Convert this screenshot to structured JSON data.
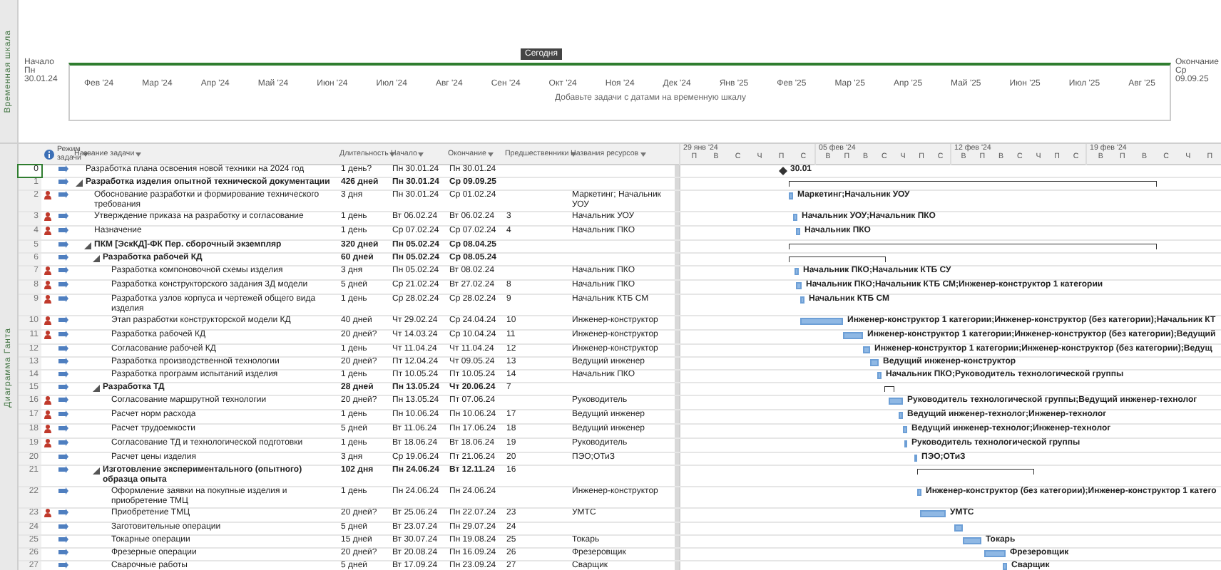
{
  "timeline": {
    "label": "Временная шкала",
    "start_label": "Начало",
    "start_date": "Пн 30.01.24",
    "today": "Сегодня",
    "hint": "Добавьте задачи с датами на временную шкалу",
    "end_label": "Окончание",
    "end_date": "Ср 09.09.25",
    "months": [
      "Фев '24",
      "Мар '24",
      "Апр '24",
      "Май '24",
      "Июн '24",
      "Июл '24",
      "Авг '24",
      "Сен '24",
      "Окт '24",
      "Ноя '24",
      "Дек '24",
      "Янв '25",
      "Фев '25",
      "Мар '25",
      "Апр '25",
      "Май '25",
      "Июн '25",
      "Июл '25",
      "Авг '25"
    ]
  },
  "view_label": "Диаграмма Ганта",
  "columns": [
    "Режим задачи",
    "Название задачи",
    "Длительность",
    "Начало",
    "Окончание",
    "Предшественники",
    "Названия ресурсов"
  ],
  "gantt_header": [
    {
      "label": "29 янв '24",
      "days": [
        "П",
        "В",
        "С",
        "Ч",
        "П",
        "С"
      ]
    },
    {
      "label": "05 фев '24",
      "days": [
        "В",
        "П",
        "В",
        "С",
        "Ч",
        "П",
        "С"
      ]
    },
    {
      "label": "12 фев '24",
      "days": [
        "В",
        "П",
        "В",
        "С",
        "Ч",
        "П",
        "С"
      ]
    },
    {
      "label": "19 фев '24",
      "days": [
        "В",
        "П",
        "В",
        "С",
        "Ч",
        "П"
      ]
    }
  ],
  "rows": [
    {
      "id": "0",
      "kind": "milestone",
      "selected": true,
      "person": false,
      "name": "Разработка плана освоения новой техники на 2024 год",
      "duration": "1 день?",
      "start": "Пн 30.01.24",
      "end": "Пн 30.01.24",
      "bar_label": "30.01"
    },
    {
      "id": "1",
      "kind": "summary",
      "selected": false,
      "person": false,
      "expanded": true,
      "name": "Разработка изделия опытной технической документации",
      "duration": "426 дней",
      "start": "Пн 30.01.24",
      "end": "Ср 09.09.25",
      "children": [
        {
          "id": "2",
          "kind": "task",
          "selected": false,
          "person": true,
          "name": "Обоснование разработки и формирование технического требования",
          "duration": "3 дня",
          "start": "Пн 30.01.24",
          "end": "Ср 01.02.24",
          "res": "Маркетинг; Начальник УОУ",
          "bar_label": "Маркетинг;Начальник УОУ"
        },
        {
          "id": "3",
          "kind": "task",
          "selected": false,
          "person": true,
          "name": "Утверждение приказа на разработку и согласование",
          "duration": "1 день",
          "start": "Вт 06.02.24",
          "end": "Вт 06.02.24",
          "pred": "3",
          "res": "Начальник УОУ",
          "bar_label": "Начальник УОУ;Начальник ПКО"
        },
        {
          "id": "4",
          "kind": "task",
          "selected": false,
          "person": true,
          "name": "Назначение",
          "duration": "1 день",
          "start": "Ср 07.02.24",
          "end": "Ср 07.02.24",
          "pred": "4",
          "res": "Начальник ПКО",
          "bar_label": "Начальник ПКО"
        },
        {
          "id": "5",
          "kind": "summary",
          "selected": false,
          "person": false,
          "expanded": true,
          "name": "ПКМ [ЭскКД]-ФК Пер. сборочный экземпляр",
          "duration": "320 дней",
          "start": "Пн 05.02.24",
          "end": "Ср 08.04.25",
          "children": [
            {
              "id": "6",
              "kind": "summary",
              "selected": false,
              "person": false,
              "expanded": true,
              "name": "Разработка рабочей КД",
              "duration": "60 дней",
              "start": "Пн 05.02.24",
              "end": "Ср 08.05.24",
              "children": [
                {
                  "id": "7",
                  "kind": "task",
                  "selected": false,
                  "person": true,
                  "name": "Разработка компоновочной схемы изделия",
                  "duration": "3 дня",
                  "start": "Пн 05.02.24",
                  "end": "Вт 08.02.24",
                  "res": "Начальник ПКО",
                  "bar_label": "Начальник ПКО;Начальник КТБ СУ"
                },
                {
                  "id": "8",
                  "kind": "task",
                  "selected": false,
                  "person": true,
                  "name": "Разработка конструкторского задания 3Д модели",
                  "duration": "5 дней",
                  "start": "Ср 21.02.24",
                  "end": "Вт 27.02.24",
                  "pred": "8",
                  "res": "Начальник ПКО",
                  "bar_label": "Начальник ПКО;Начальник КТБ СМ;Инженер-конструктор 1 категории"
                },
                {
                  "id": "9",
                  "kind": "task",
                  "selected": false,
                  "person": true,
                  "name": "Разработка узлов корпуса и чертежей общего вида изделия",
                  "duration": "1 день",
                  "start": "Ср 28.02.24",
                  "end": "Ср 28.02.24",
                  "pred": "9",
                  "res": "Начальник КТБ СМ",
                  "bar_label": "Начальник КТБ СМ"
                },
                {
                  "id": "10",
                  "kind": "task",
                  "selected": false,
                  "person": true,
                  "name": "Этап разработки конструкторской модели КД",
                  "duration": "40 дней",
                  "start": "Чт 29.02.24",
                  "end": "Ср 24.04.24",
                  "pred": "10",
                  "res": "Инженер-конструктор",
                  "bar_label": "Инженер-конструктор 1 категории;Инженер-конструктор (без категории);Начальник КТ"
                },
                {
                  "id": "11",
                  "kind": "task",
                  "selected": false,
                  "person": true,
                  "name": "Разработка рабочей КД",
                  "duration": "20 дней?",
                  "start": "Чт 14.03.24",
                  "end": "Ср 10.04.24",
                  "pred": "11",
                  "res": "Инженер-конструктор",
                  "bar_label": "Инженер-конструктор 1 категории;Инженер-конструктор (без категории);Ведущий"
                },
                {
                  "id": "12",
                  "kind": "task",
                  "selected": false,
                  "person": false,
                  "name": "Согласование рабочей КД",
                  "duration": "1 день",
                  "start": "Чт 11.04.24",
                  "end": "Чт 11.04.24",
                  "pred": "12",
                  "res": "Инженер-конструктор",
                  "bar_label": "Инженер-конструктор 1 категории;Инженер-конструктор (без категории);Ведущ"
                },
                {
                  "id": "13",
                  "kind": "task",
                  "selected": false,
                  "person": false,
                  "name": "Разработка производственной технологии",
                  "duration": "20 дней?",
                  "start": "Пт 12.04.24",
                  "end": "Чт 09.05.24",
                  "pred": "13",
                  "res": "Ведущий инженер",
                  "bar_label": "Ведущий инженер-конструктор"
                },
                {
                  "id": "14",
                  "kind": "task",
                  "selected": false,
                  "person": false,
                  "name": "Разработка программ испытаний изделия",
                  "duration": "1 день",
                  "start": "Пт 10.05.24",
                  "end": "Пт 10.05.24",
                  "pred": "14",
                  "res": "Начальник ПКО",
                  "bar_label": "Начальник ПКО;Руководитель технологической группы"
                }
              ]
            },
            {
              "id": "15",
              "kind": "summary",
              "selected": false,
              "person": false,
              "expanded": true,
              "name": "Разработка ТД",
              "duration": "28 дней",
              "start": "Пн 13.05.24",
              "end": "Чт 20.06.24",
              "pred": "7",
              "children": [
                {
                  "id": "16",
                  "kind": "task",
                  "selected": false,
                  "person": true,
                  "name": "Согласование маршрутной технологии",
                  "duration": "20 дней?",
                  "start": "Пн 13.05.24",
                  "end": "Пт 07.06.24",
                  "res": "Руководитель",
                  "bar_label": "Руководитель технологической группы;Ведущий инженер-технолог"
                },
                {
                  "id": "17",
                  "kind": "task",
                  "selected": false,
                  "person": true,
                  "name": "Расчет норм расхода",
                  "duration": "1 день",
                  "start": "Пн 10.06.24",
                  "end": "Пн 10.06.24",
                  "pred": "17",
                  "res": "Ведущий инженер",
                  "bar_label": "Ведущий инженер-технолог;Инженер-технолог"
                },
                {
                  "id": "18",
                  "kind": "task",
                  "selected": false,
                  "person": true,
                  "name": "Расчет трудоемкости",
                  "duration": "5 дней",
                  "start": "Вт 11.06.24",
                  "end": "Пн 17.06.24",
                  "pred": "18",
                  "res": "Ведущий инженер",
                  "bar_label": "Ведущий инженер-технолог;Инженер-технолог"
                },
                {
                  "id": "19",
                  "kind": "task",
                  "selected": false,
                  "person": true,
                  "name": "Согласование ТД и технологической подготовки",
                  "duration": "1 день",
                  "start": "Вт 18.06.24",
                  "end": "Вт 18.06.24",
                  "pred": "19",
                  "res": "Руководитель",
                  "bar_label": "Руководитель технологической группы"
                },
                {
                  "id": "20",
                  "kind": "task",
                  "selected": false,
                  "person": false,
                  "name": "Расчет цены изделия",
                  "duration": "3 дня",
                  "start": "Ср 19.06.24",
                  "end": "Пт 21.06.24",
                  "pred": "20",
                  "res": "ПЭО;ОТиЗ",
                  "bar_label": "ПЭО;ОТиЗ"
                }
              ]
            },
            {
              "id": "21",
              "kind": "summary",
              "selected": false,
              "person": false,
              "expanded": true,
              "name": "Изготовление экспериментального (опытного) образца опыта",
              "duration": "102 дня",
              "start": "Пн 24.06.24",
              "end": "Вт 12.11.24",
              "pred": "16",
              "children": [
                {
                  "id": "22",
                  "kind": "task",
                  "selected": false,
                  "person": false,
                  "name": "Оформление заявки на покупные изделия и приобретение ТМЦ",
                  "duration": "1 день",
                  "start": "Пн 24.06.24",
                  "end": "Пн 24.06.24",
                  "res": "Инженер-конструктор",
                  "bar_label": "Инженер-конструктор (без категории);Инженер-конструктор 1 катего"
                },
                {
                  "id": "23",
                  "kind": "task",
                  "selected": false,
                  "person": true,
                  "name": "Приобретение ТМЦ",
                  "duration": "20 дней?",
                  "start": "Вт 25.06.24",
                  "end": "Пн 22.07.24",
                  "pred": "23",
                  "res": "УМТС",
                  "bar_label": "УМТС"
                },
                {
                  "id": "24",
                  "kind": "task",
                  "selected": false,
                  "person": false,
                  "name": "Заготовительные операции",
                  "duration": "5 дней",
                  "start": "Вт 23.07.24",
                  "end": "Пн 29.07.24",
                  "pred": "24"
                },
                {
                  "id": "25",
                  "kind": "task",
                  "selected": false,
                  "person": false,
                  "name": "Токарные операции",
                  "duration": "15 дней",
                  "start": "Вт 30.07.24",
                  "end": "Пн 19.08.24",
                  "pred": "25",
                  "res": "Токарь",
                  "bar_label": "Токарь"
                },
                {
                  "id": "26",
                  "kind": "task",
                  "selected": false,
                  "person": false,
                  "name": "Фрезерные операции",
                  "duration": "20 дней?",
                  "start": "Вт 20.08.24",
                  "end": "Пн 16.09.24",
                  "pred": "26",
                  "res": "Фрезеровщик",
                  "bar_label": "Фрезеровщик"
                },
                {
                  "id": "27",
                  "kind": "task",
                  "selected": false,
                  "person": false,
                  "name": "Сварочные работы",
                  "duration": "5 дней",
                  "start": "Вт 17.09.24",
                  "end": "Пн 23.09.24",
                  "pred": "27",
                  "res": "Сварщик",
                  "bar_label": "Сварщик"
                }
              ]
            }
          ]
        }
      ]
    }
  ]
}
